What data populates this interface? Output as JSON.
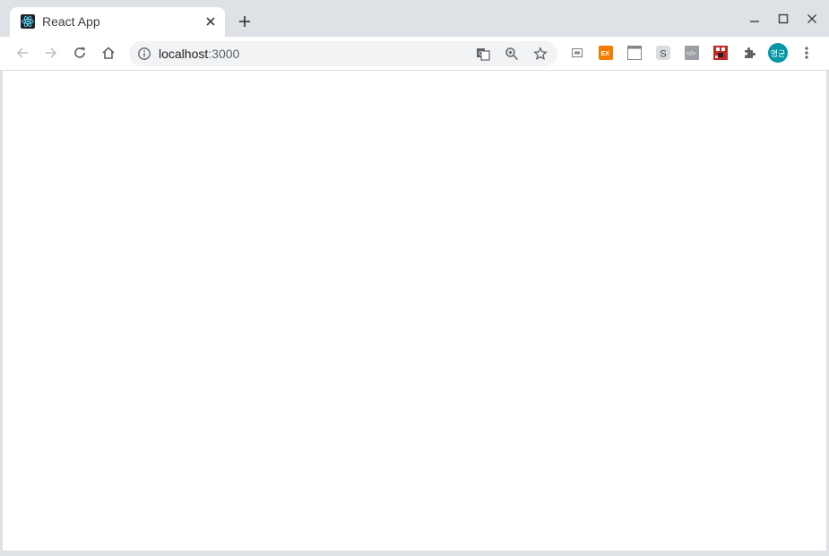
{
  "tab": {
    "title": "React App",
    "favicon": "react-logo-icon"
  },
  "window_controls": [
    "minimize-icon",
    "maximize-icon",
    "close-icon"
  ],
  "address_bar": {
    "host": "localhost",
    "port": ":3000"
  },
  "extensions": [
    {
      "name": "cast-extension-icon"
    },
    {
      "name": "ex-extension-icon",
      "label": "EX"
    },
    {
      "name": "window-extension-icon"
    },
    {
      "name": "s-extension-icon",
      "label": "S"
    },
    {
      "name": "code-extension-icon",
      "label": "</>"
    },
    {
      "name": "pixel-extension-icon"
    },
    {
      "name": "puzzle-extensions-icon"
    }
  ],
  "profile": {
    "avatar_text": "명균",
    "color": "#0097a7"
  },
  "colors": {
    "chrome_bg": "#dee1e6",
    "toolbar_bg": "#ffffff",
    "omnibox_bg": "#f1f3f4"
  }
}
